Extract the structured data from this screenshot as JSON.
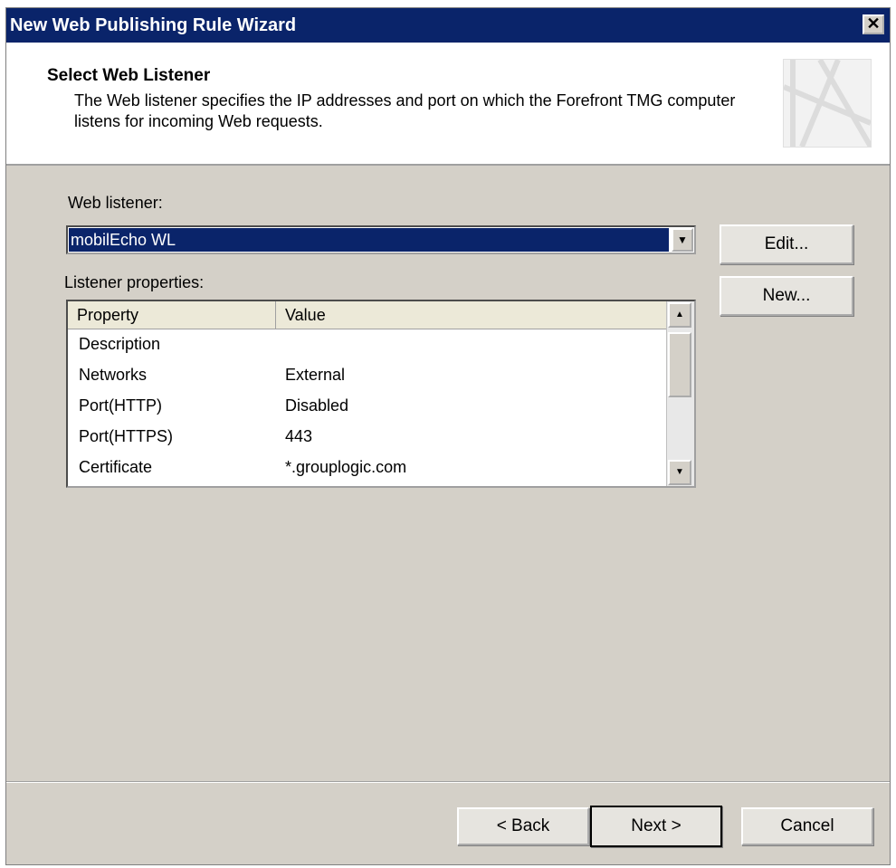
{
  "window": {
    "title": "New Web Publishing Rule Wizard",
    "close_glyph": "✕"
  },
  "header": {
    "heading": "Select Web Listener",
    "description": "The Web listener specifies the IP addresses and port on which the Forefront TMG computer listens for incoming Web requests."
  },
  "form": {
    "web_listener_label": "Web listener:",
    "web_listener_value": "mobilEcho WL",
    "properties_label": "Listener properties:",
    "edit_label": "Edit...",
    "new_label": "New..."
  },
  "table": {
    "columns": [
      "Property",
      "Value"
    ],
    "rows": [
      {
        "property": "Description",
        "value": ""
      },
      {
        "property": "Networks",
        "value": "External"
      },
      {
        "property": "Port(HTTP)",
        "value": "Disabled"
      },
      {
        "property": "Port(HTTPS)",
        "value": "443"
      },
      {
        "property": "Certificate",
        "value": "*.grouplogic.com"
      }
    ]
  },
  "footer": {
    "back_label": "< Back",
    "next_label": "Next >",
    "cancel_label": "Cancel"
  }
}
